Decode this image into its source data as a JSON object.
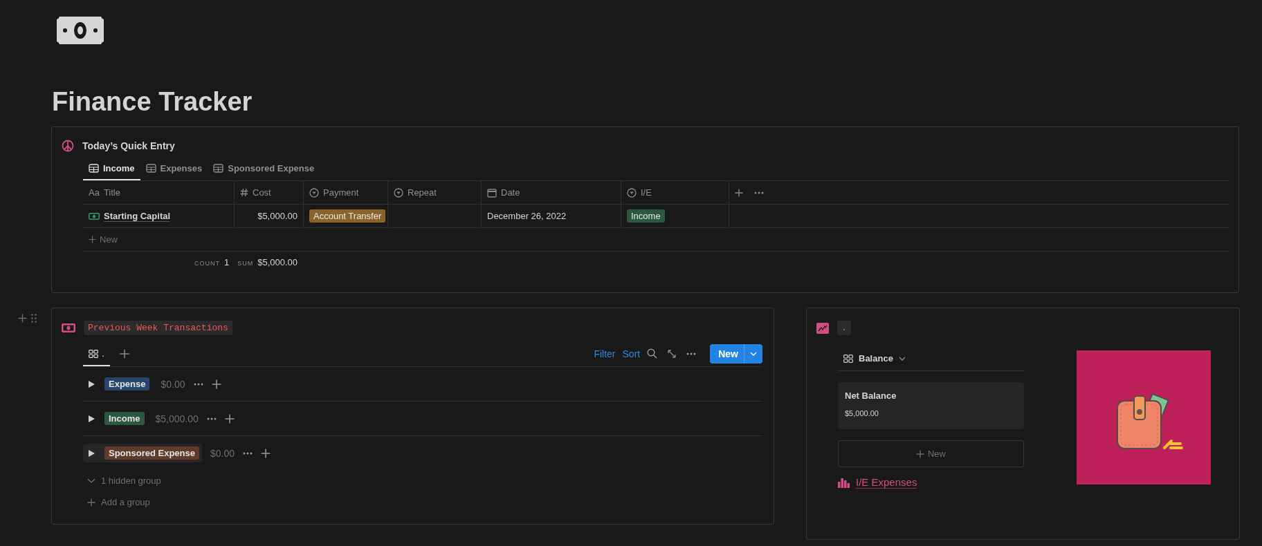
{
  "page": {
    "title": "Finance Tracker"
  },
  "quick_entry": {
    "title": "Today’s Quick Entry",
    "tabs": [
      {
        "label": "Income",
        "selected": true
      },
      {
        "label": "Expenses",
        "selected": false
      },
      {
        "label": "Sponsored Expense",
        "selected": false
      }
    ],
    "columns": [
      {
        "label": "Title",
        "kind": "title",
        "glyph": "Aa"
      },
      {
        "label": "Cost",
        "kind": "number"
      },
      {
        "label": "Payment",
        "kind": "select"
      },
      {
        "label": "Repeat",
        "kind": "select"
      },
      {
        "label": "Date",
        "kind": "date"
      },
      {
        "label": "I/E",
        "kind": "select"
      }
    ],
    "rows": [
      {
        "title": "Starting Capital",
        "cost": "$5,000.00",
        "payment": {
          "label": "Account Transfer",
          "color": "#89632a"
        },
        "date": "December 26, 2022",
        "ie": {
          "label": "Income",
          "color": "#2b593f"
        }
      }
    ],
    "new_row": "New",
    "footer": {
      "count_label": "COUNT",
      "count": "1",
      "sum_label": "SUM",
      "sum": "$5,000.00"
    }
  },
  "transactions": {
    "title": "Previous Week Transactions",
    "views": [
      {
        "label": ".",
        "selected": true
      }
    ],
    "toolbar": {
      "filter": "Filter",
      "sort": "Sort",
      "new_button": "New"
    },
    "groups": [
      {
        "label": "Expense",
        "color": "#28456c",
        "total": "$0.00",
        "expanded": false,
        "hovered": false
      },
      {
        "label": "Income",
        "color": "#2b593f",
        "total": "$5,000.00",
        "expanded": false,
        "hovered": false
      },
      {
        "label": "Sponsored Expense",
        "color": "#603b2c",
        "total": "$0.00",
        "expanded": false,
        "hovered": true
      }
    ],
    "hidden_groups": "1 hidden group",
    "add_group": "Add a group"
  },
  "balance": {
    "title": ".",
    "view": "Balance",
    "cards": [
      {
        "title": "Net Balance",
        "value": "$5,000.00"
      }
    ],
    "new_button": "New",
    "link": "I/E Expenses"
  }
}
